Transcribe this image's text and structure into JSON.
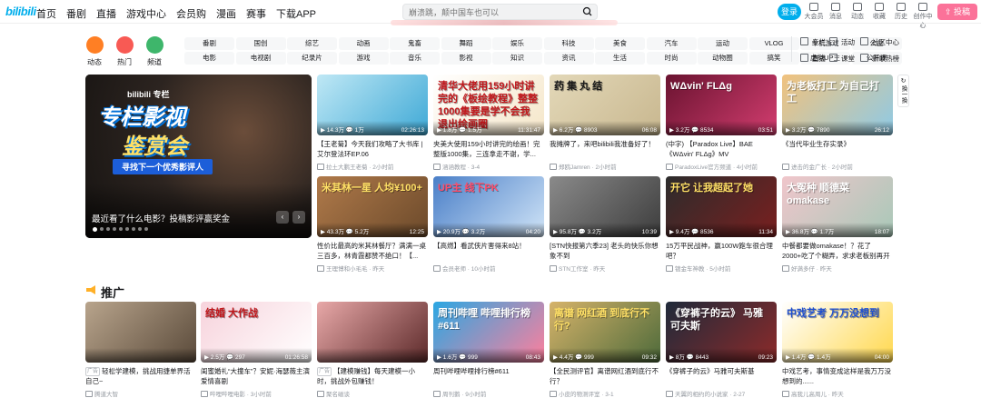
{
  "header": {
    "logo": "bilibili",
    "nav": [
      "首页",
      "番剧",
      "直播",
      "游戏中心",
      "会员购",
      "漫画",
      "赛事",
      "下载APP"
    ],
    "search_placeholder": "崩溃跳，颠中国车也可以",
    "login": "登录",
    "right": [
      "大会员",
      "消息",
      "动态",
      "收藏",
      "历史",
      "创作中心"
    ],
    "upload": "投稿"
  },
  "channels": {
    "circles": [
      {
        "label": "动态",
        "color": "#ff7f24"
      },
      {
        "label": "热门",
        "color": "#f85a54"
      },
      {
        "label": "频道",
        "color": "#3eb66b"
      }
    ],
    "tags_row1": [
      "番剧",
      "国创",
      "综艺",
      "动画",
      "鬼畜",
      "舞蹈",
      "娱乐",
      "科技",
      "美食",
      "汽车",
      "运动",
      "VLOG",
      "单机游戏",
      "公益"
    ],
    "tags_row2": [
      "电影",
      "电视剧",
      "纪录片",
      "游戏",
      "音乐",
      "影视",
      "知识",
      "资讯",
      "生活",
      "时尚",
      "动物圈",
      "搞笑",
      "虚拟UP主",
      "公开课"
    ],
    "side": [
      "专栏",
      "活动",
      "社区中心",
      "直播",
      "课堂",
      "新歌热榜"
    ]
  },
  "banner": {
    "brand": "bilibili 专栏",
    "title1": "专栏影视",
    "title2": "鉴赏会",
    "subtitle": "寻找下一个优秀影评人",
    "caption": "最近看了什么电影？投稿影评赢奖金",
    "prev": "‹",
    "next": "›"
  },
  "refresh": "换一换",
  "cards": [
    {
      "title": "【王老菊】今天我们攻略了大书库 | 艾尔登法环EP.06",
      "meta": "拉土大鹏王老菊 · 2小时前",
      "stats": "▶ 14.3万  💬 1万",
      "dur": "02:26:13",
      "bg": "#bfe8f5",
      "bg2": "#3fa9d6",
      "ttext": "",
      "tcolor": "#fff"
    },
    {
      "title": "夹美大使用159小时讲完的绘画！完整版1000集，三连拿走不谢，学...",
      "meta": "涵涵教程 · 3-4",
      "stats": "▶ 1.8万  💬 1.5万",
      "dur": "11:31:47",
      "bg": "#ffffff",
      "bg2": "#f5e6c8",
      "ttext": "清华大佬用159小时讲完的《板绘教程》整整1000集要是学不会我退出绘画圈",
      "tcolor": "#c2161b"
    },
    {
      "title": "我摊牌了，来吧bilibili我准备好了！",
      "meta": "郑鸥Jamren · 2小时前",
      "stats": "▶ 6.2万  💬 8903",
      "dur": "06:08",
      "bg": "#e3d8b8",
      "bg2": "#c8b78f",
      "ttext": "药  集 丸  结",
      "tcolor": "#1a1a1a"
    },
    {
      "title": "(中字) 【Paradox Live】BAE《WΔvin' FLΔg》MV",
      "meta": "ParadoxLive官方频道 · 4小时前",
      "stats": "▶ 3.2万  💬 8534",
      "dur": "03:51",
      "bg": "#6a1330",
      "bg2": "#d23d6f",
      "ttext": "WΔvin' FLΔg",
      "tcolor": "#fff"
    },
    {
      "title": "《当代毕业生存实录》",
      "meta": "进击的金广长 · 2小时前",
      "stats": "▶ 3.2万  💬 7890",
      "dur": "26:12",
      "bg": "#f1c27d",
      "bg2": "#8ecae6",
      "ttext": "为老板打工  为自己打工",
      "tcolor": "#fff"
    },
    {
      "title": "性价比最高的米其林餐厅？满满一桌三百多，林青霞都赞不绝口！【...",
      "meta": "王理博和小毛毛 · 昨天",
      "stats": "▶ 43.3万  💬 5.2万",
      "dur": "12:25",
      "bg": "#b07a4a",
      "bg2": "#6c4a2b",
      "ttext": "米其林一星  人均¥100+",
      "tcolor": "#ffe066"
    },
    {
      "title": "【高燃】看武侠片害得来8站！",
      "meta": "会员老师 · 10小时前",
      "stats": "▶ 20.9万  💬 3.2万",
      "dur": "04:20",
      "bg": "#4a7fc8",
      "bg2": "#d0e4f7",
      "ttext": "UP主  线下PK",
      "tcolor": "#ff4d6a"
    },
    {
      "title": "[STN快报第六季23] 老头的快乐你想象不到",
      "meta": "STN工作室 · 昨天",
      "stats": "▶ 95.8万  💬 3.2万",
      "dur": "10:39",
      "bg": "#8a8a8a",
      "bg2": "#3d3d3d",
      "ttext": "",
      "tcolor": "#fff"
    },
    {
      "title": "15万平民战神，赢100W跑车很合理吧？",
      "meta": "镀金车神教 · 5小时前",
      "stats": "▶ 9.4万  💬 8536",
      "dur": "11:34",
      "bg": "#2c2c2c",
      "bg2": "#7a1f1f",
      "ttext": "开它 让我超起了她",
      "tcolor": "#ffe066"
    },
    {
      "title": "中餐都要做omakase！？花了2000+吃了个糊弄，求求老板别再开了！",
      "meta": "好满多仔 · 昨天",
      "stats": "▶ 36.8万  💬 1.7万",
      "dur": "18:07",
      "bg": "#f0c6cb",
      "bg2": "#a8c8b8",
      "ttext": "大冤种  顺德菜omakase",
      "tcolor": "#fff"
    },
    {
      "title": "轻松学建模，挑战用捷单界活自己~",
      "meta": "腾道大智",
      "stats": "",
      "dur": "",
      "bg": "#b8a48c",
      "bg2": "#5a4a3a",
      "ttext": "",
      "tcolor": "#fff",
      "ad": "广告"
    },
    {
      "title": "闺蜜婚礼“大撞车”？安妮·海瑟薇主演爱情喜剧",
      "meta": "哔哩哔哩电影 · 3小时前",
      "stats": "▶ 2.5万  💬 297",
      "dur": "01:26:58",
      "bg": "#f7d3dc",
      "bg2": "#ffffff",
      "ttext": "结婚  大作战",
      "tcolor": "#c2161b"
    },
    {
      "title": "【建模赚钱】每天建模一小时，挑战外包赚钱！",
      "meta": "聚名磁谈",
      "stats": "",
      "dur": "",
      "bg": "#e8a8a8",
      "bg2": "#5c2a2a",
      "ttext": "",
      "tcolor": "#fff",
      "ad": "广告"
    },
    {
      "title": "周刊哔哩哔哩排行榜#611",
      "meta": "周刊鹅 · 9小时前",
      "stats": "▶ 1.6万  💬 999",
      "dur": "08:43",
      "bg": "#2aa7e3",
      "bg2": "#ff7f9c",
      "ttext": "周刊哔哩 哔哩排行榜 #611",
      "tcolor": "#fff"
    },
    {
      "title": "【全民测评官】离谱网红酒到底行不行？",
      "meta": "小皮的物测评室 · 3-1",
      "stats": "▶ 4.4万  💬 999",
      "dur": "09:32",
      "bg": "#d6b36a",
      "bg2": "#4d6a3a",
      "ttext": "离谱 网红酒 到底行不行?",
      "tcolor": "#ffe066"
    },
    {
      "title": "《穿裤子的云》马雅可夫斯基",
      "meta": "天翼的相约的小说家 · 2-27",
      "stats": "▶ 8万  💬 8443",
      "dur": "09:23",
      "bg": "#1f2a3a",
      "bg2": "#8c2a2a",
      "ttext": "《穿裤子的云》 马雅可夫斯",
      "tcolor": "#fff"
    },
    {
      "title": "中戏艺考，事情变成这样是我万万没想到的......",
      "meta": "高我儿高周儿 · 昨天",
      "stats": "▶ 1.4万  💬 1.4万",
      "dur": "04:00",
      "bg": "#ffffff",
      "bg2": "#ffd84d",
      "ttext": "中戏艺考  万万没想到",
      "tcolor": "#1e4fd1"
    }
  ],
  "section": {
    "title": "推广"
  }
}
